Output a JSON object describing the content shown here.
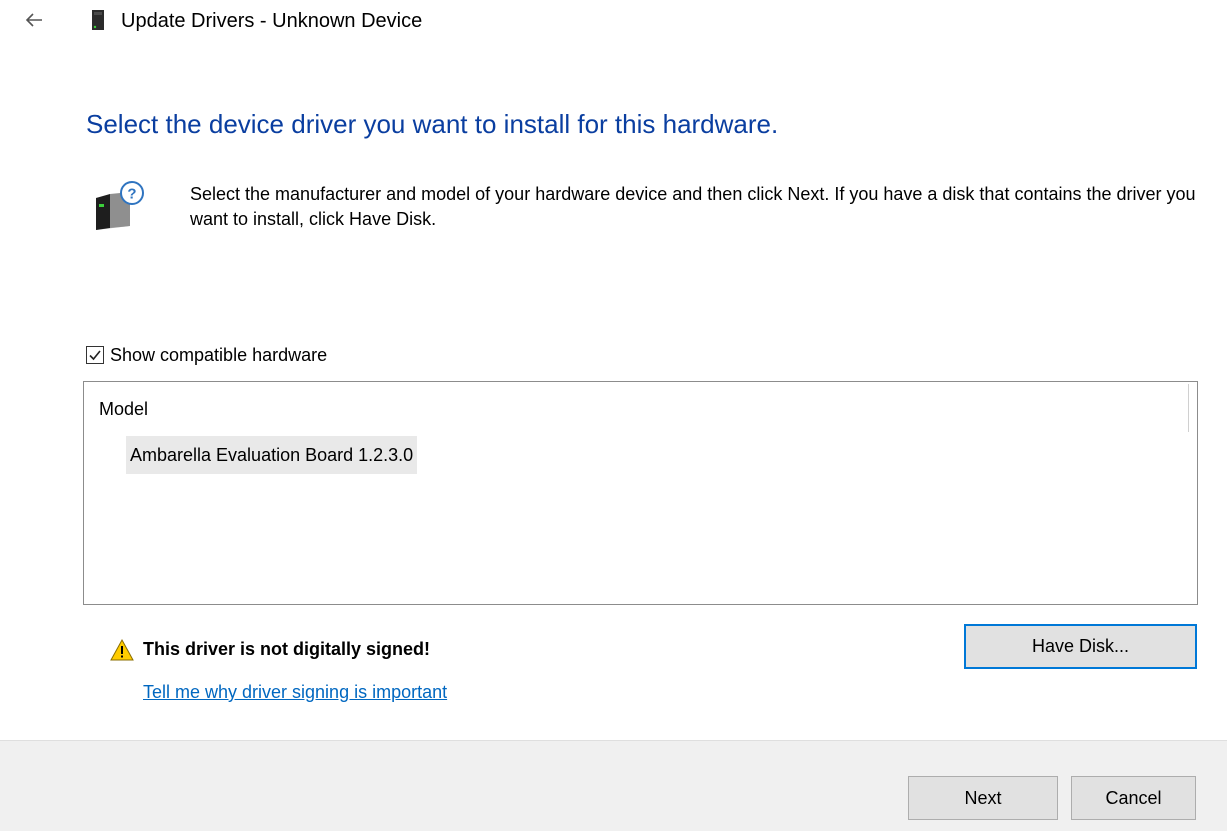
{
  "window": {
    "title": "Update Drivers - Unknown Device"
  },
  "main": {
    "heading": "Select the device driver you want to install for this hardware.",
    "instructions": "Select the manufacturer and model of your hardware device and then click Next. If you have a disk that contains the driver you want to install, click Have Disk."
  },
  "compatible": {
    "label": "Show compatible hardware",
    "checked": true
  },
  "model_list": {
    "header": "Model",
    "items": [
      "Ambarella Evaluation Board 1.2.3.0"
    ],
    "selected_index": 0
  },
  "warning": {
    "text": "This driver is not digitally signed!",
    "link_text": "Tell me why driver signing is important"
  },
  "buttons": {
    "have_disk": "Have Disk...",
    "next": "Next",
    "cancel": "Cancel"
  },
  "colors": {
    "heading": "#0a3ea0",
    "link": "#0067c0",
    "focus_border": "#0078d7",
    "warning_yellow": "#ffcc00",
    "footer_bg": "#f0f0f0"
  },
  "icons": {
    "back": "back-arrow-icon",
    "device": "device-icon",
    "unknown_hardware": "unknown-hardware-icon",
    "warning": "warning-icon",
    "checkmark": "checkmark-icon"
  }
}
